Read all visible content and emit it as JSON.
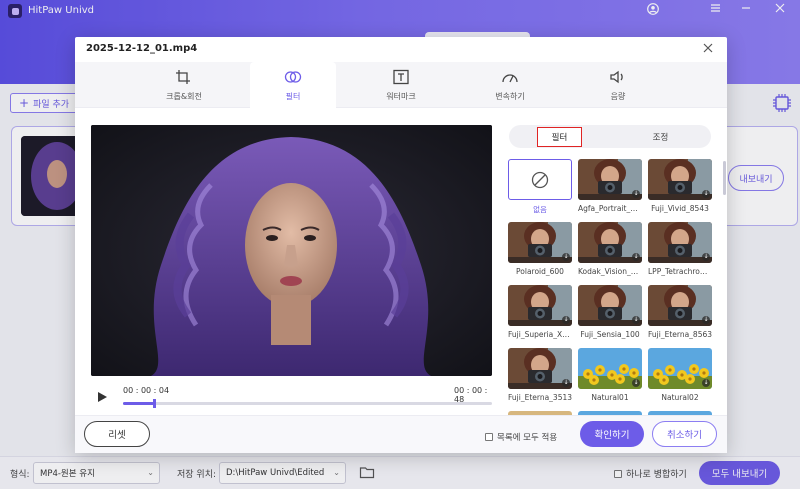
{
  "app": {
    "title": "HitPaw Univd",
    "add_file_label": "파일 추가",
    "export_label": "내보내기",
    "format_label": "형식:",
    "format_value": "MP4-원본 유지",
    "save_location_label": "저장 위치:",
    "save_location_value": "D:\\HitPaw Univd\\Edited",
    "merge_label": "하나로 병합하기",
    "export_all_label": "모두 내보내기"
  },
  "modal": {
    "title": "2025-12-12_01.mp4",
    "tabs": [
      {
        "label": "크롭&회전",
        "icon": "crop-icon"
      },
      {
        "label": "필터",
        "icon": "filter-icon",
        "active": true
      },
      {
        "label": "워터마크",
        "icon": "watermark-icon"
      },
      {
        "label": "변속하기",
        "icon": "speed-icon"
      },
      {
        "label": "음량",
        "icon": "volume-icon"
      }
    ],
    "player": {
      "current_time": "00 : 00 : 04",
      "total_time": "00 : 00 : 48",
      "progress": 0.083
    },
    "segment": {
      "filter_label": "필터",
      "adjust_label": "조정",
      "active": "filter"
    },
    "filters": [
      {
        "name": "없음",
        "type": "none",
        "selected": true
      },
      {
        "name": "Agfa_Portrait_X...",
        "type": "camera",
        "download": true
      },
      {
        "name": "Fuji_Vivid_8543",
        "type": "camera",
        "download": true
      },
      {
        "name": "Polaroid_600",
        "type": "camera",
        "download": true
      },
      {
        "name": "Kodak_Vision_2...",
        "type": "camera",
        "download": true
      },
      {
        "name": "LPP_Tetrachrom...",
        "type": "camera",
        "download": true
      },
      {
        "name": "Fuji_Superia_Xtr...",
        "type": "camera",
        "download": true
      },
      {
        "name": "Fuji_Sensia_100",
        "type": "camera",
        "download": true
      },
      {
        "name": "Fuji_Eterna_8563",
        "type": "camera",
        "download": true
      },
      {
        "name": "Fuji_Eterna_3513",
        "type": "camera",
        "download": true
      },
      {
        "name": "Natural01",
        "type": "flowers",
        "download": true
      },
      {
        "name": "Natural02",
        "type": "flowers",
        "download": true
      }
    ],
    "footer": {
      "reset_label": "리셋",
      "apply_all_label": "목록에 모두 적용",
      "confirm_label": "확인하기",
      "cancel_label": "취소하기"
    }
  },
  "colors": {
    "accent": "#6d5ce8",
    "highlight_box": "#e02424"
  }
}
